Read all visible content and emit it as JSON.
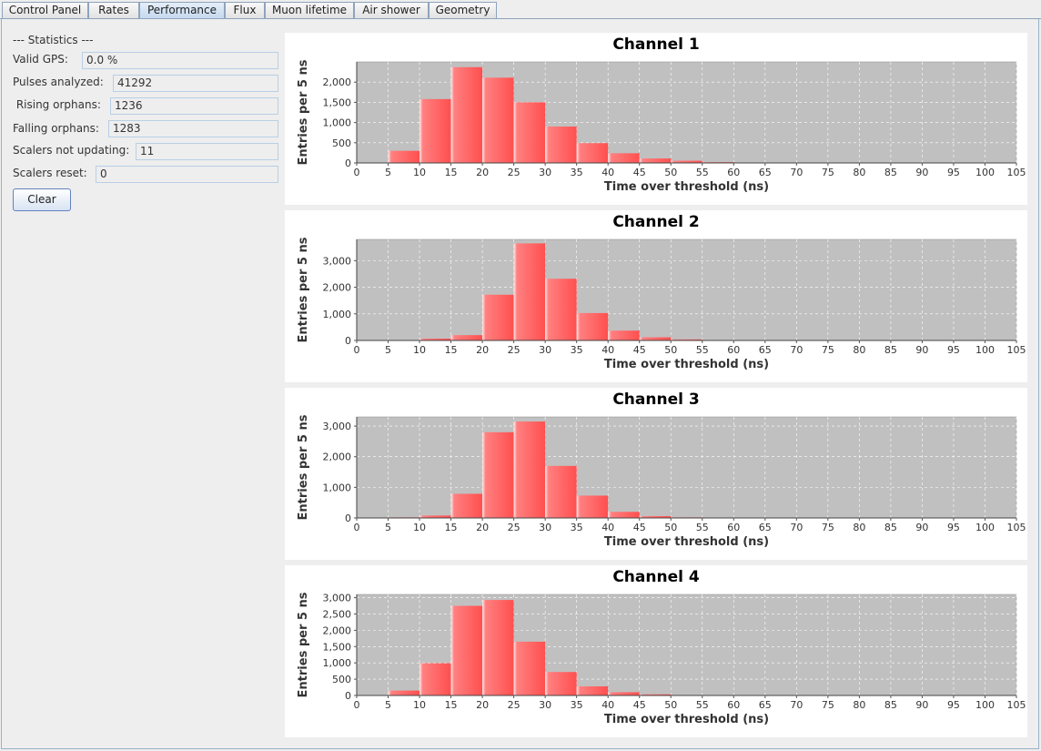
{
  "tabs": [
    {
      "label": "Control Panel",
      "active": false
    },
    {
      "label": "Rates",
      "active": false
    },
    {
      "label": "Performance",
      "active": true
    },
    {
      "label": "Flux",
      "active": false
    },
    {
      "label": "Muon lifetime",
      "active": false
    },
    {
      "label": "Air shower",
      "active": false
    },
    {
      "label": "Geometry",
      "active": false
    }
  ],
  "stats": {
    "title": "--- Statistics ---",
    "valid_gps_label": "Valid GPS:",
    "valid_gps_value": "0.0 %",
    "pulses_label": "Pulses analyzed:",
    "pulses_value": "41292",
    "rising_label": " Rising orphans:",
    "rising_value": "1236",
    "falling_label": "Falling orphans:",
    "falling_value": "1283",
    "scalers_not_updating_label": "Scalers not updating:",
    "scalers_not_updating_value": "11",
    "scalers_reset_label": "Scalers reset:",
    "scalers_reset_value": "0",
    "clear_label": "Clear"
  },
  "colors": {
    "bar": "#ff6a6a",
    "plot_bg": "#c0c0c0",
    "grid": "#ffffff"
  },
  "chart_data": [
    {
      "type": "bar",
      "title": "Channel 1",
      "xlabel": "Time over threshold (ns)",
      "ylabel": "Entries per 5 ns",
      "xlim": [
        0,
        105
      ],
      "ylim": [
        0,
        2500
      ],
      "xticks": [
        0,
        5,
        10,
        15,
        20,
        25,
        30,
        35,
        40,
        45,
        50,
        55,
        60,
        65,
        70,
        75,
        80,
        85,
        90,
        95,
        100,
        105
      ],
      "yticks": [
        0,
        500,
        1000,
        1500,
        2000
      ],
      "ytick_labels": [
        "0",
        "500",
        "1,000",
        "1,500",
        "2,000"
      ],
      "bin_width": 5,
      "x": [
        0,
        5,
        10,
        15,
        20,
        25,
        30,
        35,
        40,
        45,
        50,
        55,
        60,
        65,
        70,
        75,
        80,
        85,
        90,
        95,
        100
      ],
      "values": [
        10,
        300,
        1580,
        2370,
        2110,
        1500,
        900,
        490,
        240,
        110,
        55,
        20,
        8,
        4,
        2,
        0,
        0,
        0,
        0,
        0,
        0
      ],
      "grid": true
    },
    {
      "type": "bar",
      "title": "Channel 2",
      "xlabel": "Time over threshold (ns)",
      "ylabel": "Entries per 5 ns",
      "xlim": [
        0,
        105
      ],
      "ylim": [
        0,
        3800
      ],
      "xticks": [
        0,
        5,
        10,
        15,
        20,
        25,
        30,
        35,
        40,
        45,
        50,
        55,
        60,
        65,
        70,
        75,
        80,
        85,
        90,
        95,
        100,
        105
      ],
      "yticks": [
        0,
        1000,
        2000,
        3000
      ],
      "ytick_labels": [
        "0",
        "1,000",
        "2,000",
        "3,000"
      ],
      "bin_width": 5,
      "x": [
        0,
        5,
        10,
        15,
        20,
        25,
        30,
        35,
        40,
        45,
        50,
        55,
        60,
        65,
        70,
        75,
        80,
        85,
        90,
        95,
        100
      ],
      "values": [
        5,
        15,
        70,
        200,
        1720,
        3650,
        2320,
        1030,
        370,
        120,
        40,
        15,
        5,
        2,
        0,
        0,
        0,
        0,
        0,
        0,
        0
      ],
      "grid": true
    },
    {
      "type": "bar",
      "title": "Channel 3",
      "xlabel": "Time over threshold (ns)",
      "ylabel": "Entries per 5 ns",
      "xlim": [
        0,
        105
      ],
      "ylim": [
        0,
        3300
      ],
      "xticks": [
        0,
        5,
        10,
        15,
        20,
        25,
        30,
        35,
        40,
        45,
        50,
        55,
        60,
        65,
        70,
        75,
        80,
        85,
        90,
        95,
        100,
        105
      ],
      "yticks": [
        0,
        1000,
        2000,
        3000
      ],
      "ytick_labels": [
        "0",
        "1,000",
        "2,000",
        "3,000"
      ],
      "bin_width": 5,
      "x": [
        0,
        5,
        10,
        15,
        20,
        25,
        30,
        35,
        40,
        45,
        50,
        55,
        60,
        65,
        70,
        75,
        80,
        85,
        90,
        95,
        100
      ],
      "values": [
        5,
        20,
        80,
        790,
        2800,
        3150,
        1700,
        730,
        200,
        60,
        20,
        8,
        3,
        0,
        0,
        0,
        0,
        0,
        0,
        0,
        0
      ],
      "grid": true
    },
    {
      "type": "bar",
      "title": "Channel 4",
      "xlabel": "Time over threshold (ns)",
      "ylabel": "Entries per 5 ns",
      "xlim": [
        0,
        105
      ],
      "ylim": [
        0,
        3100
      ],
      "xticks": [
        0,
        5,
        10,
        15,
        20,
        25,
        30,
        35,
        40,
        45,
        50,
        55,
        60,
        65,
        70,
        75,
        80,
        85,
        90,
        95,
        100,
        105
      ],
      "yticks": [
        0,
        500,
        1000,
        1500,
        2000,
        2500,
        3000
      ],
      "ytick_labels": [
        "0",
        "500",
        "1,000",
        "1,500",
        "2,000",
        "2,500",
        "3,000"
      ],
      "bin_width": 5,
      "x": [
        0,
        5,
        10,
        15,
        20,
        25,
        30,
        35,
        40,
        45,
        50,
        55,
        60,
        65,
        70,
        75,
        80,
        85,
        90,
        95,
        100
      ],
      "values": [
        10,
        150,
        990,
        2750,
        2930,
        1650,
        720,
        280,
        100,
        35,
        15,
        5,
        2,
        0,
        0,
        0,
        0,
        0,
        0,
        0,
        0
      ],
      "grid": true
    }
  ]
}
